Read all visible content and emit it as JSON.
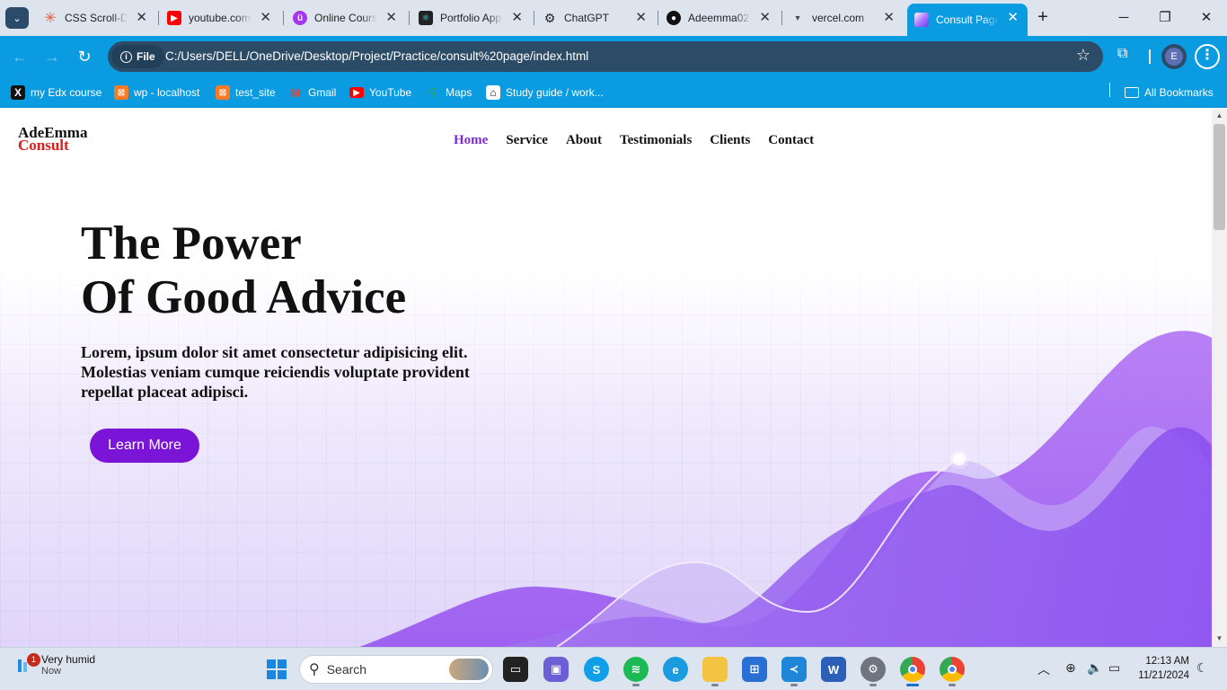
{
  "browser": {
    "tabs": [
      {
        "title": "CSS Scroll-Dr",
        "icon": "css-asterisk-icon",
        "color": "#e05a3b"
      },
      {
        "title": "youtube.com",
        "icon": "youtube-icon",
        "color": "#ff0000"
      },
      {
        "title": "Online Cours",
        "icon": "udemy-icon",
        "color": "#a435f0"
      },
      {
        "title": "Portfolio App",
        "icon": "react-icon",
        "color": "#222222"
      },
      {
        "title": "ChatGPT",
        "icon": "chatgpt-icon",
        "color": "#222222"
      },
      {
        "title": "Adeemma02",
        "icon": "github-icon",
        "color": "#111111"
      },
      {
        "title": "vercel.com",
        "icon": "vercel-icon",
        "color": "#444444"
      },
      {
        "title": "Consult Page",
        "icon": "page-icon",
        "color": "#7a5cf0",
        "active": true
      }
    ],
    "new_tab": "+",
    "address": {
      "chip": "File",
      "url": "C:/Users/DELL/OneDrive/Desktop/Project/Practice/consult%20page/index.html"
    },
    "profile_initial": "E",
    "bookmarks": [
      {
        "label": "my Edx course",
        "icon": "edx-icon"
      },
      {
        "label": "wp - localhost",
        "icon": "xampp-icon"
      },
      {
        "label": "test_site",
        "icon": "xampp-icon"
      },
      {
        "label": "Gmail",
        "icon": "gmail-icon"
      },
      {
        "label": "YouTube",
        "icon": "youtube-icon"
      },
      {
        "label": "Maps",
        "icon": "maps-icon"
      },
      {
        "label": "Study guide / work...",
        "icon": "museum-icon"
      }
    ],
    "all_bookmarks": "All Bookmarks"
  },
  "site": {
    "logo_top": "AdeEmma",
    "logo_bottom": "Consult",
    "nav": [
      "Home",
      "Service",
      "About",
      "Testimonials",
      "Clients",
      "Contact"
    ],
    "active_nav": "Home",
    "hero_line1": "The Power",
    "hero_line2": "Of Good Advice",
    "lead": "Lorem, ipsum dolor sit amet consectetur adipisicing elit. Molestias veniam cumque reiciendis voluptate provident repellat placeat adipisci.",
    "cta": "Learn More",
    "accent": "#7a14d6",
    "logo_accent": "#e01b1b"
  },
  "taskbar": {
    "weather_title": "Very humid",
    "weather_sub": "Now",
    "weather_badge": "1",
    "search_placeholder": "Search",
    "time": "12:13 AM",
    "date": "11/21/2024",
    "apps": [
      "windows-start-icon",
      "task-view-icon",
      "teams-icon",
      "skype-icon",
      "spotify-icon",
      "edge-icon",
      "file-explorer-icon",
      "store-icon",
      "vscode-icon",
      "word-icon",
      "settings-icon",
      "chrome-icon",
      "chrome-profile-icon"
    ]
  }
}
